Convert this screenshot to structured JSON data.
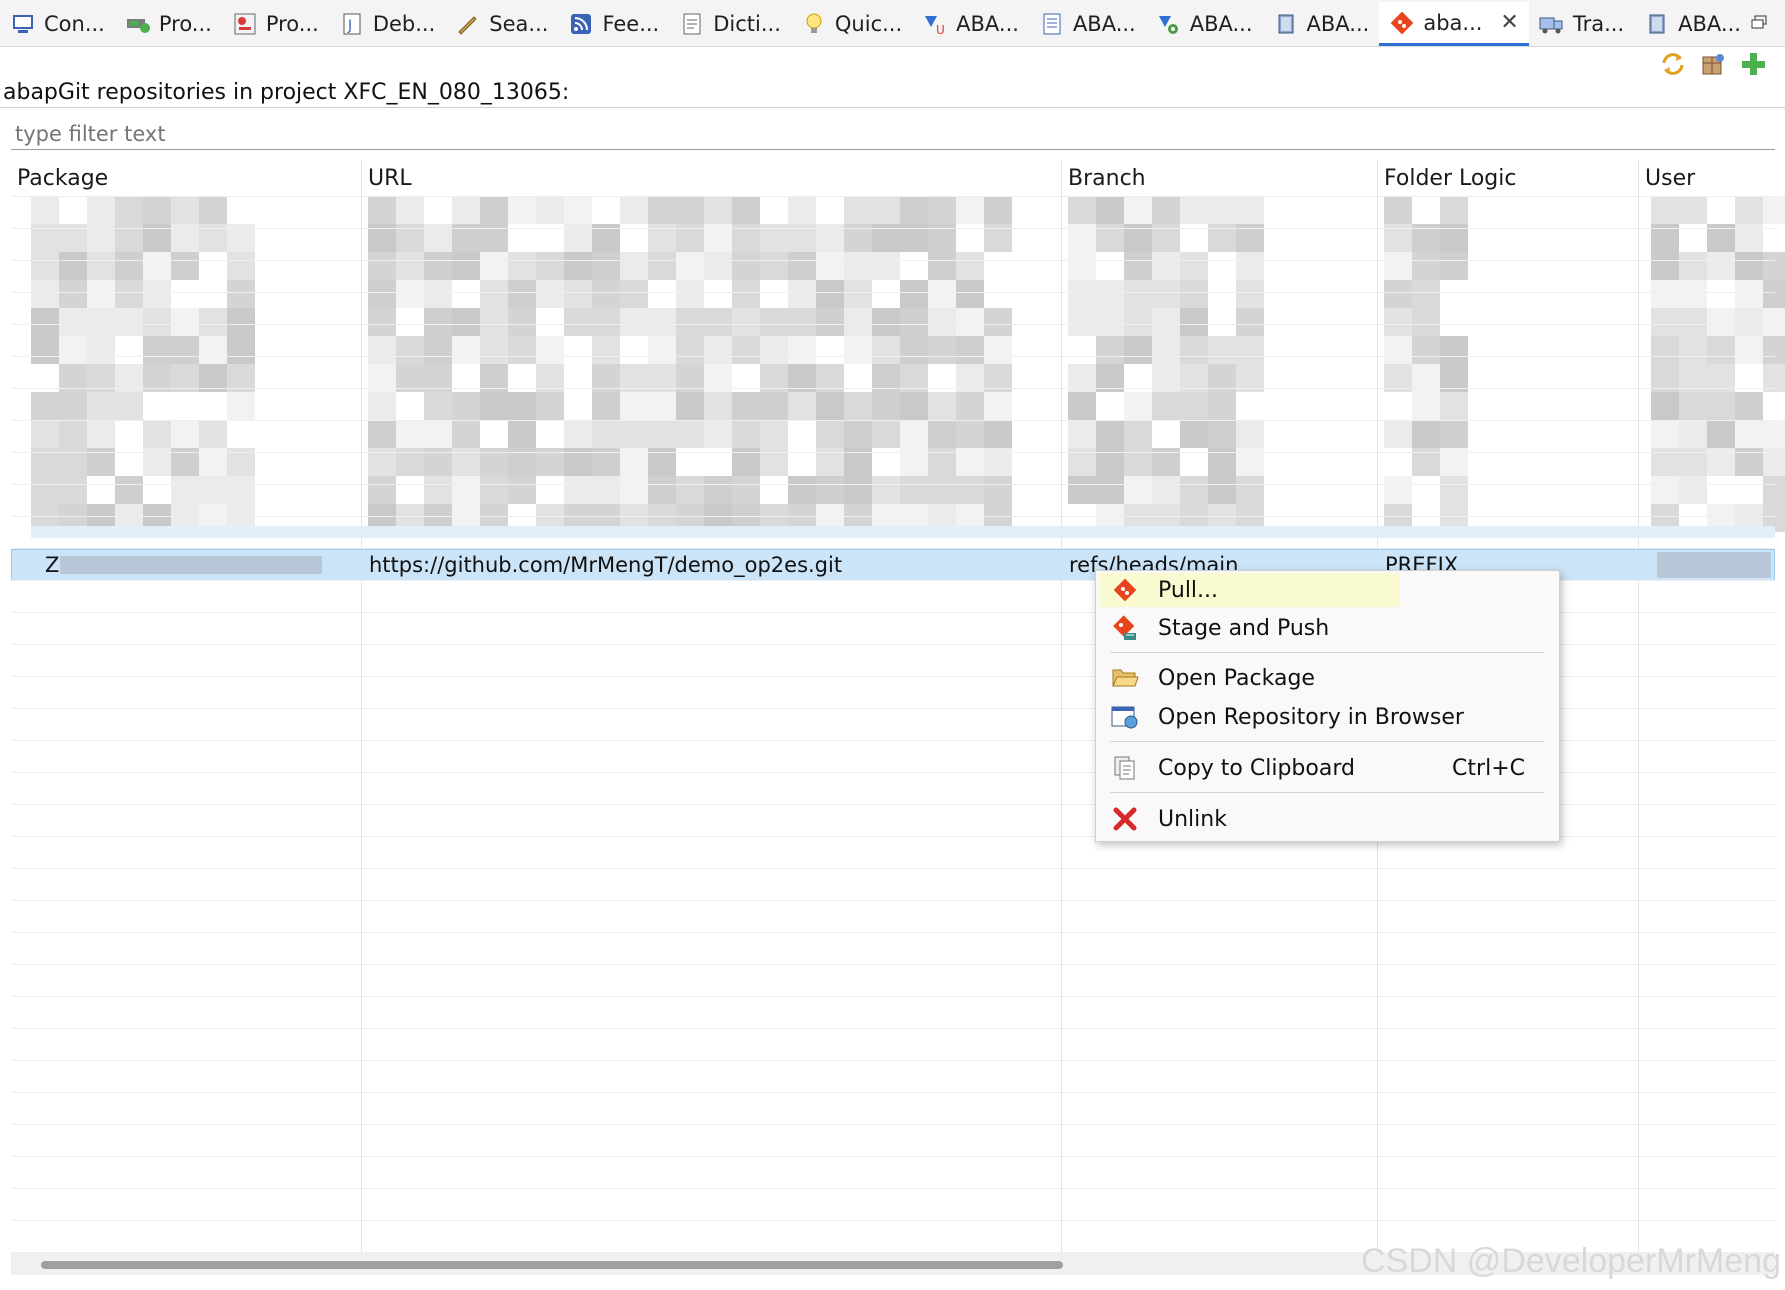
{
  "tabs": [
    {
      "label": "Con...",
      "icon": "console-icon"
    },
    {
      "label": "Pro...",
      "icon": "progress-icon"
    },
    {
      "label": "Pro...",
      "icon": "problems-icon"
    },
    {
      "label": "Deb...",
      "icon": "debug-icon"
    },
    {
      "label": "Sea...",
      "icon": "search-icon"
    },
    {
      "label": "Fee...",
      "icon": "feed-icon"
    },
    {
      "label": "Dicti...",
      "icon": "dictionary-icon"
    },
    {
      "label": "Quic...",
      "icon": "lightbulb-icon"
    },
    {
      "label": "ABA...",
      "icon": "abap-unit-icon"
    },
    {
      "label": "ABA...",
      "icon": "abap-doc-icon"
    },
    {
      "label": "ABA...",
      "icon": "abap-gear-icon"
    },
    {
      "label": "ABA...",
      "icon": "abap-book-icon"
    },
    {
      "label": "aba...",
      "icon": "abapgit-icon",
      "active": true
    },
    {
      "label": "Tra...",
      "icon": "transport-icon"
    },
    {
      "label": "ABA...",
      "icon": "abap-book-icon"
    }
  ],
  "view": {
    "title": "abapGit repositories in project XFC_EN_080_13065:",
    "filter_placeholder": "type filter text"
  },
  "table": {
    "columns": [
      "Package",
      "URL",
      "Branch",
      "Folder Logic",
      "User"
    ],
    "selected_row": {
      "package": "Z",
      "url": "https://github.com/MrMengT/demo_op2es.git",
      "branch": "refs/heads/main",
      "folder_logic": "PREFIX"
    }
  },
  "context_menu": {
    "items": [
      {
        "label": "Pull...",
        "icon": "abapgit-pull-icon",
        "highlighted": true
      },
      {
        "label": "Stage and Push",
        "icon": "abapgit-push-icon"
      },
      {
        "label": "Open Package",
        "icon": "folder-open-icon"
      },
      {
        "label": "Open Repository in Browser",
        "icon": "browser-icon"
      },
      {
        "label": "Copy to Clipboard",
        "icon": "clipboard-icon",
        "shortcut": "Ctrl+C"
      },
      {
        "label": "Unlink",
        "icon": "unlink-icon"
      }
    ]
  },
  "watermark": "CSDN @DeveloperMrMeng",
  "colors": {
    "accent": "#2f6fd6",
    "selection": "#cce4f7",
    "highlight": "#fafad0",
    "abapgit": "#e8451e"
  }
}
